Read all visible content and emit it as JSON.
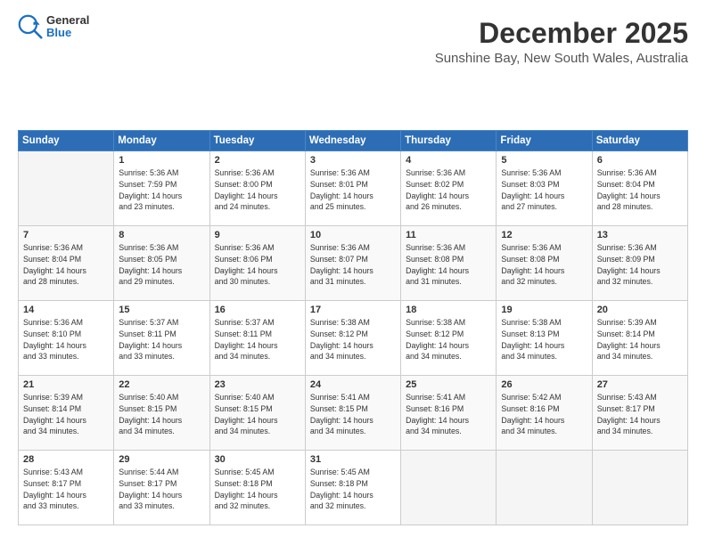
{
  "logo": {
    "line1": "General",
    "line2": "Blue"
  },
  "header": {
    "month": "December 2025",
    "location": "Sunshine Bay, New South Wales, Australia"
  },
  "weekdays": [
    "Sunday",
    "Monday",
    "Tuesday",
    "Wednesday",
    "Thursday",
    "Friday",
    "Saturday"
  ],
  "weeks": [
    [
      {
        "day": "",
        "sunrise": "",
        "sunset": "",
        "daylight": ""
      },
      {
        "day": "1",
        "sunrise": "5:36 AM",
        "sunset": "7:59 PM",
        "daylight": "14 hours and 23 minutes."
      },
      {
        "day": "2",
        "sunrise": "5:36 AM",
        "sunset": "8:00 PM",
        "daylight": "14 hours and 24 minutes."
      },
      {
        "day": "3",
        "sunrise": "5:36 AM",
        "sunset": "8:01 PM",
        "daylight": "14 hours and 25 minutes."
      },
      {
        "day": "4",
        "sunrise": "5:36 AM",
        "sunset": "8:02 PM",
        "daylight": "14 hours and 26 minutes."
      },
      {
        "day": "5",
        "sunrise": "5:36 AM",
        "sunset": "8:03 PM",
        "daylight": "14 hours and 27 minutes."
      },
      {
        "day": "6",
        "sunrise": "5:36 AM",
        "sunset": "8:04 PM",
        "daylight": "14 hours and 28 minutes."
      }
    ],
    [
      {
        "day": "7",
        "sunrise": "5:36 AM",
        "sunset": "8:04 PM",
        "daylight": "14 hours and 28 minutes."
      },
      {
        "day": "8",
        "sunrise": "5:36 AM",
        "sunset": "8:05 PM",
        "daylight": "14 hours and 29 minutes."
      },
      {
        "day": "9",
        "sunrise": "5:36 AM",
        "sunset": "8:06 PM",
        "daylight": "14 hours and 30 minutes."
      },
      {
        "day": "10",
        "sunrise": "5:36 AM",
        "sunset": "8:07 PM",
        "daylight": "14 hours and 31 minutes."
      },
      {
        "day": "11",
        "sunrise": "5:36 AM",
        "sunset": "8:08 PM",
        "daylight": "14 hours and 31 minutes."
      },
      {
        "day": "12",
        "sunrise": "5:36 AM",
        "sunset": "8:08 PM",
        "daylight": "14 hours and 32 minutes."
      },
      {
        "day": "13",
        "sunrise": "5:36 AM",
        "sunset": "8:09 PM",
        "daylight": "14 hours and 32 minutes."
      }
    ],
    [
      {
        "day": "14",
        "sunrise": "5:36 AM",
        "sunset": "8:10 PM",
        "daylight": "14 hours and 33 minutes."
      },
      {
        "day": "15",
        "sunrise": "5:37 AM",
        "sunset": "8:11 PM",
        "daylight": "14 hours and 33 minutes."
      },
      {
        "day": "16",
        "sunrise": "5:37 AM",
        "sunset": "8:11 PM",
        "daylight": "14 hours and 34 minutes."
      },
      {
        "day": "17",
        "sunrise": "5:38 AM",
        "sunset": "8:12 PM",
        "daylight": "14 hours and 34 minutes."
      },
      {
        "day": "18",
        "sunrise": "5:38 AM",
        "sunset": "8:12 PM",
        "daylight": "14 hours and 34 minutes."
      },
      {
        "day": "19",
        "sunrise": "5:38 AM",
        "sunset": "8:13 PM",
        "daylight": "14 hours and 34 minutes."
      },
      {
        "day": "20",
        "sunrise": "5:39 AM",
        "sunset": "8:14 PM",
        "daylight": "14 hours and 34 minutes."
      }
    ],
    [
      {
        "day": "21",
        "sunrise": "5:39 AM",
        "sunset": "8:14 PM",
        "daylight": "14 hours and 34 minutes."
      },
      {
        "day": "22",
        "sunrise": "5:40 AM",
        "sunset": "8:15 PM",
        "daylight": "14 hours and 34 minutes."
      },
      {
        "day": "23",
        "sunrise": "5:40 AM",
        "sunset": "8:15 PM",
        "daylight": "14 hours and 34 minutes."
      },
      {
        "day": "24",
        "sunrise": "5:41 AM",
        "sunset": "8:15 PM",
        "daylight": "14 hours and 34 minutes."
      },
      {
        "day": "25",
        "sunrise": "5:41 AM",
        "sunset": "8:16 PM",
        "daylight": "14 hours and 34 minutes."
      },
      {
        "day": "26",
        "sunrise": "5:42 AM",
        "sunset": "8:16 PM",
        "daylight": "14 hours and 34 minutes."
      },
      {
        "day": "27",
        "sunrise": "5:43 AM",
        "sunset": "8:17 PM",
        "daylight": "14 hours and 34 minutes."
      }
    ],
    [
      {
        "day": "28",
        "sunrise": "5:43 AM",
        "sunset": "8:17 PM",
        "daylight": "14 hours and 33 minutes."
      },
      {
        "day": "29",
        "sunrise": "5:44 AM",
        "sunset": "8:17 PM",
        "daylight": "14 hours and 33 minutes."
      },
      {
        "day": "30",
        "sunrise": "5:45 AM",
        "sunset": "8:18 PM",
        "daylight": "14 hours and 32 minutes."
      },
      {
        "day": "31",
        "sunrise": "5:45 AM",
        "sunset": "8:18 PM",
        "daylight": "14 hours and 32 minutes."
      },
      {
        "day": "",
        "sunrise": "",
        "sunset": "",
        "daylight": ""
      },
      {
        "day": "",
        "sunrise": "",
        "sunset": "",
        "daylight": ""
      },
      {
        "day": "",
        "sunrise": "",
        "sunset": "",
        "daylight": ""
      }
    ]
  ]
}
